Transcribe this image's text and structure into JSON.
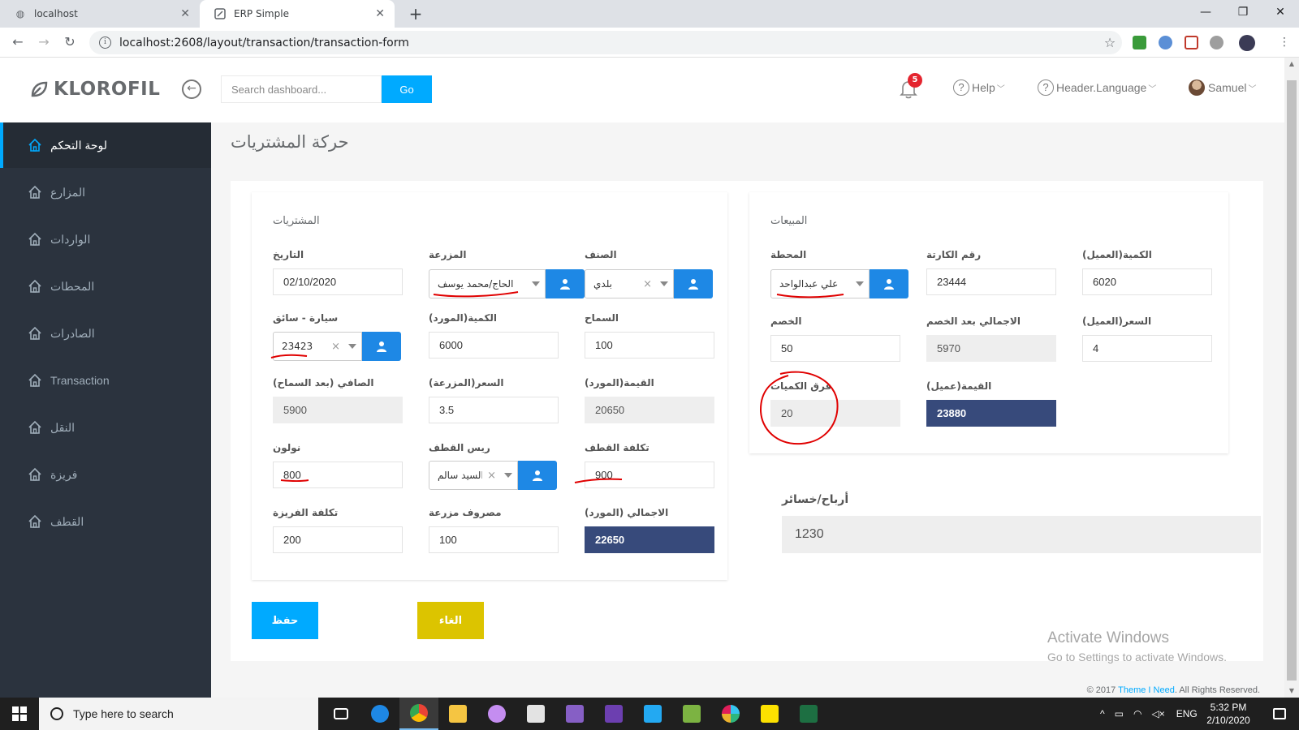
{
  "browser": {
    "tabs": [
      {
        "title": "localhost",
        "active": false
      },
      {
        "title": "ERP Simple",
        "active": true
      }
    ],
    "url": "localhost:2608/layout/transaction/transaction-form"
  },
  "header": {
    "brand": "KLOROFIL",
    "search_placeholder": "Search dashboard...",
    "go_label": "Go",
    "notification_count": "5",
    "help_label": "Help",
    "language_label": "Header.Language",
    "user_label": "Samuel"
  },
  "sidebar": {
    "items": [
      {
        "label": "لوحة التحكم",
        "active": true
      },
      {
        "label": "المزارع"
      },
      {
        "label": "الواردات"
      },
      {
        "label": "المحطات"
      },
      {
        "label": "الصادرات"
      },
      {
        "label": "Transaction"
      },
      {
        "label": "النقل"
      },
      {
        "label": "فريزة"
      },
      {
        "label": "القطف"
      }
    ]
  },
  "page_title": "حركة المشتريات",
  "purchases": {
    "title": "المشتريات",
    "date": {
      "label": "التاريخ",
      "value": "02/10/2020"
    },
    "farm": {
      "label": "المزرعة",
      "value": "الحاج/محمد يوسف"
    },
    "variety": {
      "label": "الصنف",
      "value": "بلدي"
    },
    "vehicle": {
      "label": "سيارة - سائق",
      "value": "23423"
    },
    "supplier_qty": {
      "label": "الكمية(المورد)",
      "value": "6000"
    },
    "allowance": {
      "label": "السماح",
      "value": "100"
    },
    "net": {
      "label": "الصافي (بعد السماح)",
      "value": "5900"
    },
    "farm_price": {
      "label": "السعر(المزرعة)",
      "value": "3.5"
    },
    "supplier_value": {
      "label": "القيمة(المورد)",
      "value": "20650"
    },
    "freight": {
      "label": "نولون",
      "value": "800"
    },
    "harvest_head": {
      "label": "ريس القطف",
      "value": "السيد سالم"
    },
    "harvest_cost": {
      "label": "تكلفة القطف",
      "value": "900"
    },
    "freezer_cost": {
      "label": "تكلفة الفريزة",
      "value": "200"
    },
    "farm_expense": {
      "label": "مصروف مزرعة",
      "value": "100"
    },
    "supplier_total": {
      "label": "الاجمالي (المورد)",
      "value": "22650"
    }
  },
  "sales": {
    "title": "المبيعات",
    "station": {
      "label": "المحطة",
      "value": "علي عبدالواحد"
    },
    "card_number": {
      "label": "رقم الكارتة",
      "value": "23444"
    },
    "client_qty": {
      "label": "الكمية(العميل)",
      "value": "6020"
    },
    "discount": {
      "label": "الخصم",
      "value": "50"
    },
    "total_after_discount": {
      "label": "الاجمالي بعد الخصم",
      "value": "5970"
    },
    "client_price": {
      "label": "السعر(العميل)",
      "value": "4"
    },
    "qty_diff": {
      "label": "فرق الكميات",
      "value": "20"
    },
    "client_value": {
      "label": "القيمة(عميل)",
      "value": "23880"
    }
  },
  "profit": {
    "label": "أرباح/خسائر",
    "value": "1230"
  },
  "actions": {
    "save": "حفظ",
    "cancel": "الغاء"
  },
  "watermark": {
    "line1": "Activate Windows",
    "line2": "Go to Settings to activate Windows."
  },
  "footer": {
    "prefix": "© 2017 ",
    "link": "Theme I Need",
    "suffix": ". All Rights Reserved."
  },
  "taskbar": {
    "search_placeholder": "Type here to search",
    "language": "ENG",
    "time": "5:32 PM",
    "date": "2/10/2020"
  },
  "colors": {
    "accent": "#00aaff",
    "sidebar": "#2b333e",
    "total_box": "#374a7b",
    "cancel": "#dcc400",
    "annotation": "#e00000"
  }
}
